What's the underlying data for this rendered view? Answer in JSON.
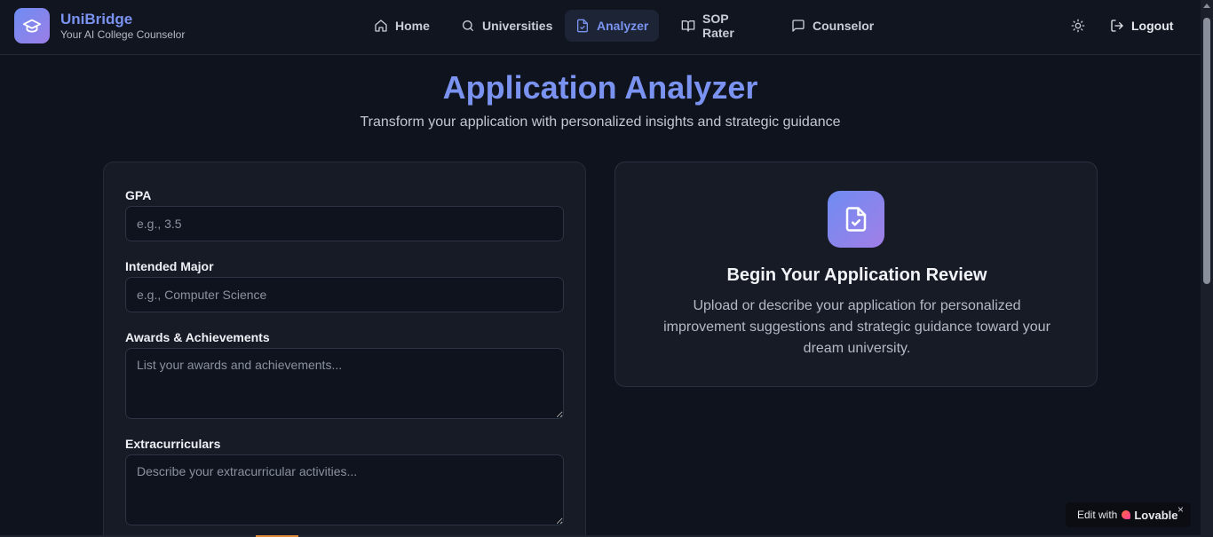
{
  "brand": {
    "name": "UniBridge",
    "tagline": "Your AI College Counselor"
  },
  "nav": {
    "items": [
      {
        "label": "Home",
        "icon": "home-icon",
        "active": false
      },
      {
        "label": "Universities",
        "icon": "search-icon",
        "active": false
      },
      {
        "label": "Analyzer",
        "icon": "document-icon",
        "active": true
      },
      {
        "label": "SOP Rater",
        "icon": "book-icon",
        "active": false
      },
      {
        "label": "Counselor",
        "icon": "chat-icon",
        "active": false
      }
    ],
    "logout_label": "Logout"
  },
  "page": {
    "title": "Application Analyzer",
    "subtitle": "Transform your application with personalized insights and strategic guidance"
  },
  "form": {
    "gpa": {
      "label": "GPA",
      "placeholder": "e.g., 3.5",
      "value": ""
    },
    "major": {
      "label": "Intended Major",
      "placeholder": "e.g., Computer Science",
      "value": ""
    },
    "awards": {
      "label": "Awards & Achievements",
      "placeholder": "List your awards and achievements...",
      "value": ""
    },
    "extracurriculars": {
      "label": "Extracurriculars",
      "placeholder": "Describe your extracurricular activities...",
      "value": ""
    }
  },
  "review": {
    "title": "Begin Your Application Review",
    "text": "Upload or describe your application for personalized improvement suggestions and strategic guidance toward your dream university."
  },
  "badge": {
    "prefix": "Edit with",
    "brand": "Lovable",
    "close": "×"
  },
  "colors": {
    "accent": "#7b93f0",
    "background": "#0f131d",
    "card": "#171b26"
  }
}
